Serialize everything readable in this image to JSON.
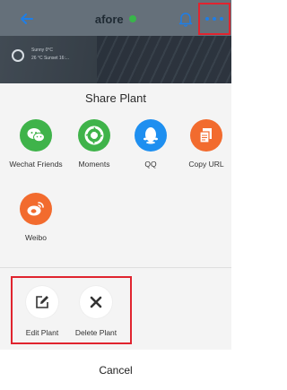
{
  "header": {
    "title": "afore",
    "back_icon": "back-arrow-icon",
    "bell_icon": "bell-icon",
    "more_icon": "more-icon",
    "accent_color": "#1d7ee8",
    "verified_color": "#38b54a",
    "highlight_color": "#e0242f"
  },
  "weather": {
    "line1": "Sunny 0°C",
    "line2": "26 °C  Sunset 16:..."
  },
  "share_sheet": {
    "title": "Share Plant",
    "options": [
      {
        "label": "Wechat Friends",
        "icon": "wechat-icon",
        "color": "#3fb34a"
      },
      {
        "label": "Moments",
        "icon": "moments-icon",
        "color": "#3fb34a"
      },
      {
        "label": "QQ",
        "icon": "qq-icon",
        "color": "#1e8ff0"
      },
      {
        "label": "Copy URL",
        "icon": "copy-url-icon",
        "color": "#f26b2e"
      },
      {
        "label": "Weibo",
        "icon": "weibo-icon",
        "color": "#f26b2e"
      }
    ],
    "manage": [
      {
        "label": "Edit Plant",
        "icon": "edit-icon"
      },
      {
        "label": "Delete Plant",
        "icon": "delete-icon"
      }
    ],
    "cancel_label": "Cancel"
  }
}
